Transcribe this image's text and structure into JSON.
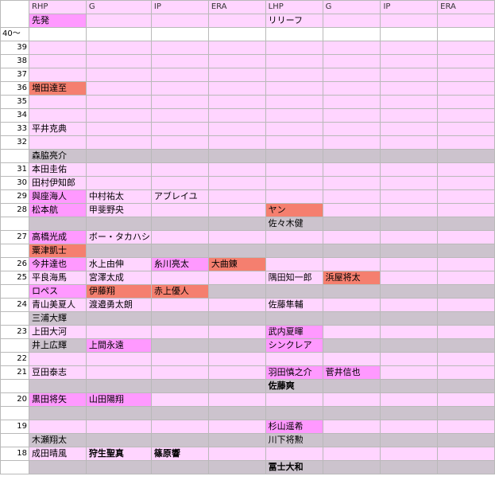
{
  "colors": {
    "pink": "#ffd5ff",
    "white": "#ffffff",
    "magenta": "#ff99ff",
    "salmon": "#f57f6f",
    "gray": "#ccc3cd"
  },
  "header": {
    "columns": [
      "RHP",
      "G",
      "IP",
      "ERA",
      "LHP",
      "G",
      "IP",
      "ERA"
    ],
    "sub_right": "先発",
    "sub_left": "リリーフ"
  },
  "rows": [
    {
      "age": "40～",
      "kind": "sub",
      "cells": []
    },
    {
      "age": "39",
      "cells": []
    },
    {
      "age": "38",
      "cells": []
    },
    {
      "age": "37",
      "cells": []
    },
    {
      "age": "36",
      "cells": [
        {
          "col": 0,
          "text": "増田達至",
          "bg": "salmon"
        }
      ]
    },
    {
      "age": "35",
      "cells": []
    },
    {
      "age": "34",
      "cells": []
    },
    {
      "age": "33",
      "cells": [
        {
          "col": 0,
          "text": "平井克典"
        }
      ]
    },
    {
      "age": "32",
      "cells": []
    },
    {
      "age": "",
      "kind": "gray",
      "cells": [
        {
          "col": 0,
          "text": "森脇亮介"
        }
      ]
    },
    {
      "age": "31",
      "cells": [
        {
          "col": 0,
          "text": "本田圭佑"
        }
      ]
    },
    {
      "age": "30",
      "cells": [
        {
          "col": 0,
          "text": "田村伊知郎"
        }
      ]
    },
    {
      "age": "29",
      "cells": [
        {
          "col": 0,
          "text": "與座海人",
          "bg": "magenta"
        },
        {
          "col": 1,
          "text": "中村祐太"
        },
        {
          "col": 2,
          "text": "アブレイユ"
        }
      ]
    },
    {
      "age": "28",
      "cells": [
        {
          "col": 0,
          "text": "松本航",
          "bg": "magenta"
        },
        {
          "col": 1,
          "text": "甲斐野央"
        },
        {
          "col": 4,
          "text": "ヤン",
          "bg": "salmon"
        }
      ]
    },
    {
      "age": "",
      "kind": "gray",
      "cells": [
        {
          "col": 4,
          "text": "佐々木健"
        }
      ]
    },
    {
      "age": "27",
      "cells": [
        {
          "col": 0,
          "text": "高橋光成",
          "bg": "magenta"
        },
        {
          "col": 1,
          "text": "ボー・タカハシ"
        }
      ]
    },
    {
      "age": "",
      "kind": "gray",
      "cells": [
        {
          "col": 0,
          "text": "粟津凱士",
          "bg": "salmon"
        }
      ]
    },
    {
      "age": "26",
      "cells": [
        {
          "col": 0,
          "text": "今井達也",
          "bg": "magenta"
        },
        {
          "col": 1,
          "text": "水上由伸"
        },
        {
          "col": 2,
          "text": "糸川亮太",
          "bg": "magenta"
        },
        {
          "col": 3,
          "text": "大曲錬",
          "bg": "salmon"
        }
      ]
    },
    {
      "age": "25",
      "cells": [
        {
          "col": 0,
          "text": "平良海馬"
        },
        {
          "col": 1,
          "text": "宮澤太成"
        },
        {
          "col": 4,
          "text": "隅田知一郎"
        },
        {
          "col": 5,
          "text": "浜屋将太",
          "bg": "salmon"
        }
      ]
    },
    {
      "age": "",
      "kind": "gray",
      "cells": [
        {
          "col": 0,
          "text": "ロペス",
          "bg": "magenta"
        },
        {
          "col": 1,
          "text": "伊藤翔",
          "bg": "salmon"
        },
        {
          "col": 2,
          "text": "赤上優人",
          "bg": "salmon"
        }
      ]
    },
    {
      "age": "24",
      "cells": [
        {
          "col": 0,
          "text": "青山美夏人"
        },
        {
          "col": 1,
          "text": "渡邉勇太朗"
        },
        {
          "col": 4,
          "text": "佐藤隼輔"
        }
      ]
    },
    {
      "age": "",
      "kind": "gray",
      "cells": [
        {
          "col": 0,
          "text": "三浦大輝"
        }
      ]
    },
    {
      "age": "23",
      "cells": [
        {
          "col": 0,
          "text": "上田大河"
        },
        {
          "col": 4,
          "text": "武内夏暉",
          "bg": "magenta"
        }
      ]
    },
    {
      "age": "",
      "kind": "gray",
      "cells": [
        {
          "col": 0,
          "text": "井上広輝"
        },
        {
          "col": 1,
          "text": "上間永遠",
          "bg": "magenta"
        },
        {
          "col": 4,
          "text": "シンクレア",
          "bg": "magenta"
        }
      ]
    },
    {
      "age": "22",
      "cells": []
    },
    {
      "age": "21",
      "cells": [
        {
          "col": 0,
          "text": "豆田泰志"
        },
        {
          "col": 4,
          "text": "羽田慎之介",
          "bg": "magenta"
        },
        {
          "col": 5,
          "text": "菅井信也",
          "bg": "magenta"
        }
      ]
    },
    {
      "age": "",
      "kind": "gray",
      "cells": [
        {
          "col": 4,
          "text": "佐藤爽",
          "bold": true
        }
      ]
    },
    {
      "age": "20",
      "cells": [
        {
          "col": 0,
          "text": "黒田将矢",
          "bg": "magenta"
        },
        {
          "col": 1,
          "text": "山田陽翔",
          "bg": "magenta"
        }
      ]
    },
    {
      "age": "",
      "kind": "gray",
      "cells": []
    },
    {
      "age": "19",
      "cells": [
        {
          "col": 4,
          "text": "杉山遥希",
          "bg": "magenta"
        }
      ]
    },
    {
      "age": "",
      "kind": "gray",
      "cells": [
        {
          "col": 0,
          "text": "木瀬翔太"
        },
        {
          "col": 4,
          "text": "川下将勲"
        }
      ]
    },
    {
      "age": "18",
      "cells": [
        {
          "col": 0,
          "text": "成田晴風"
        },
        {
          "col": 1,
          "text": "狩生聖真",
          "bold": true
        },
        {
          "col": 2,
          "text": "篠原響",
          "bold": true
        }
      ]
    },
    {
      "age": "",
      "kind": "gray",
      "cells": [
        {
          "col": 4,
          "text": "冨士大和",
          "bold": true
        }
      ]
    }
  ]
}
